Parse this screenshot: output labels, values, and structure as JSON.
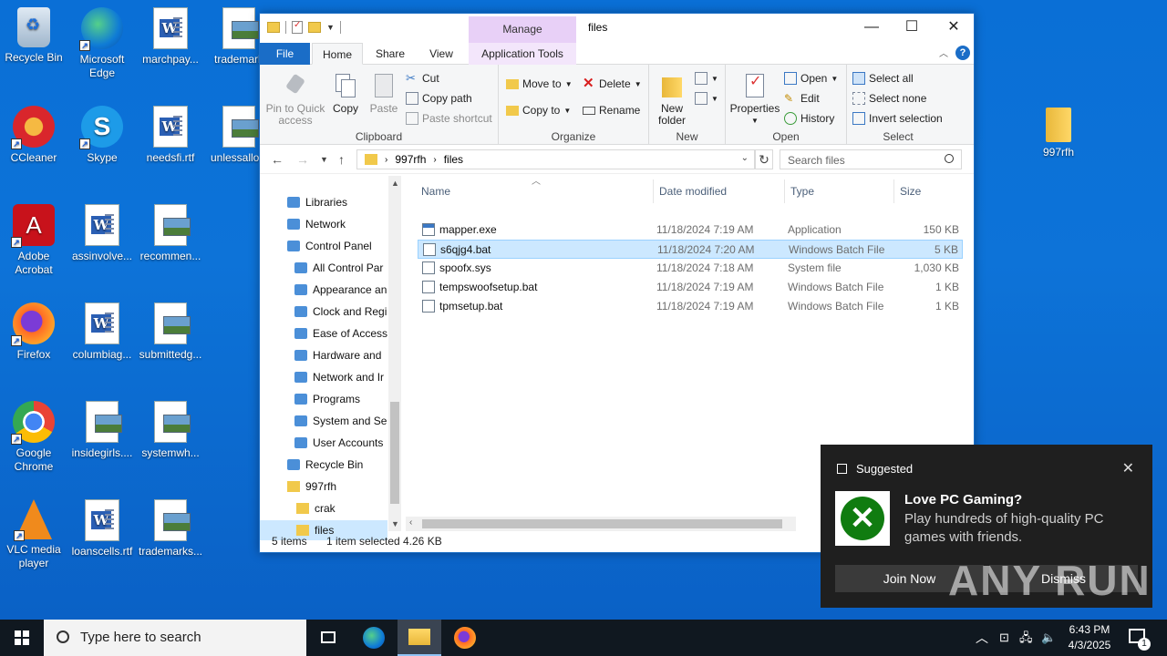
{
  "desktop": {
    "icons": [
      {
        "label": "Recycle Bin"
      },
      {
        "label": "Microsoft Edge"
      },
      {
        "label": "marchpay..."
      },
      {
        "label": "trademark"
      },
      {
        "label": "CCleaner"
      },
      {
        "label": "Skype"
      },
      {
        "label": "needsfi.rtf"
      },
      {
        "label": "unlessallow"
      },
      {
        "label": "Adobe Acrobat"
      },
      {
        "label": "assinvolve..."
      },
      {
        "label": "recommen..."
      },
      {
        "label": "Firefox"
      },
      {
        "label": "columbiag..."
      },
      {
        "label": "submittedg..."
      },
      {
        "label": "Google Chrome"
      },
      {
        "label": "insidegirls...."
      },
      {
        "label": "systemwh..."
      },
      {
        "label": "VLC media player"
      },
      {
        "label": "loanscells.rtf"
      },
      {
        "label": "trademarks..."
      },
      {
        "label": "997rfh"
      }
    ]
  },
  "explorer": {
    "title": "files",
    "manage_label": "Manage",
    "tabs": {
      "file": "File",
      "home": "Home",
      "share": "Share",
      "view": "View",
      "app_tools": "Application Tools"
    },
    "ribbon": {
      "clipboard": {
        "label": "Clipboard",
        "pin": "Pin to Quick access",
        "copy": "Copy",
        "paste": "Paste",
        "cut": "Cut",
        "copy_path": "Copy path",
        "paste_shortcut": "Paste shortcut"
      },
      "organize": {
        "label": "Organize",
        "move_to": "Move to",
        "copy_to": "Copy to",
        "delete": "Delete",
        "rename": "Rename"
      },
      "new": {
        "label": "New",
        "new_folder": "New folder"
      },
      "open": {
        "label": "Open",
        "properties": "Properties",
        "open": "Open",
        "edit": "Edit",
        "history": "History"
      },
      "select": {
        "label": "Select",
        "select_all": "Select all",
        "select_none": "Select none",
        "invert": "Invert selection"
      }
    },
    "address": {
      "crumbs": [
        "997rfh",
        "files"
      ]
    },
    "search_placeholder": "Search files",
    "nav": [
      {
        "label": "Libraries"
      },
      {
        "label": "Network"
      },
      {
        "label": "Control Panel"
      },
      {
        "label": "All Control Par"
      },
      {
        "label": "Appearance an"
      },
      {
        "label": "Clock and Regi"
      },
      {
        "label": "Ease of Access"
      },
      {
        "label": "Hardware and"
      },
      {
        "label": "Network and Ir"
      },
      {
        "label": "Programs"
      },
      {
        "label": "System and Se"
      },
      {
        "label": "User Accounts"
      },
      {
        "label": "Recycle Bin"
      },
      {
        "label": "997rfh"
      },
      {
        "label": "crak"
      },
      {
        "label": "files"
      }
    ],
    "columns": {
      "name": "Name",
      "date": "Date modified",
      "type": "Type",
      "size": "Size"
    },
    "files": [
      {
        "name": "mapper.exe",
        "date": "11/18/2024 7:19 AM",
        "type": "Application",
        "size": "150 KB"
      },
      {
        "name": "s6qjg4.bat",
        "date": "11/18/2024 7:20 AM",
        "type": "Windows Batch File",
        "size": "5 KB"
      },
      {
        "name": "spoofx.sys",
        "date": "11/18/2024 7:18 AM",
        "type": "System file",
        "size": "1,030 KB"
      },
      {
        "name": "tempswoofsetup.bat",
        "date": "11/18/2024 7:19 AM",
        "type": "Windows Batch File",
        "size": "1 KB"
      },
      {
        "name": "tpmsetup.bat",
        "date": "11/18/2024 7:19 AM",
        "type": "Windows Batch File",
        "size": "1 KB"
      }
    ],
    "status": {
      "items": "5 items",
      "selected": "1 item selected",
      "size": "4.26 KB"
    }
  },
  "toast": {
    "header": "Suggested",
    "title": "Love PC Gaming?",
    "body": "Play hundreds of high-quality PC games with friends.",
    "join": "Join Now",
    "dismiss": "Dismiss"
  },
  "watermark": "ANY RUN",
  "taskbar": {
    "search_placeholder": "Type here to search",
    "time": "6:43 PM",
    "date": "4/3/2025",
    "notification_count": "1"
  }
}
